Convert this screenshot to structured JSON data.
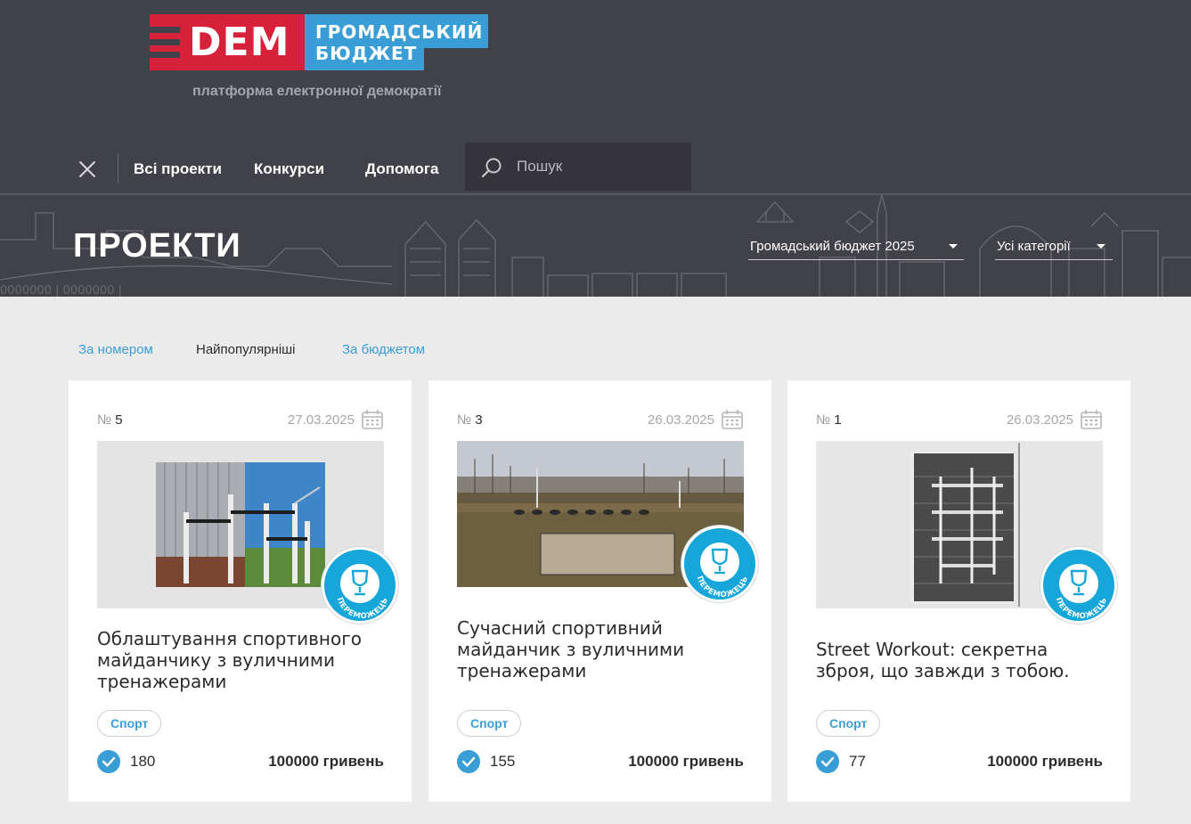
{
  "header": {
    "logo_main": "DEM",
    "logo_line1": "ГРОМАДСЬКИЙ",
    "logo_line2": "БЮДЖЕТ",
    "tagline": "платформа електронної демократії"
  },
  "nav": {
    "links": [
      "Всі проекти",
      "Конкурси",
      "Допомога"
    ],
    "search_placeholder": "Пошук"
  },
  "page": {
    "title": "ПРОЕКТИ",
    "filter_budget": "Громадський бюджет 2025",
    "filter_category": "Усі категорії"
  },
  "sort": {
    "by_number": "За номером",
    "popular": "Найпопулярніші",
    "by_budget": "За бюджетом"
  },
  "colors": {
    "header_bg": "#414149",
    "brand_red": "#d7213a",
    "brand_blue": "#3a9ed6",
    "badge_blue": "#17a6d9",
    "page_bg": "#ebebeb"
  },
  "badge_text": "ПЕРЕМОЖЕЦЬ",
  "projects": [
    {
      "num_symbol": "№",
      "num": "5",
      "date": "27.03.2025",
      "title": "Облаштування спортивного майданчику з вуличними тренажерами",
      "tag": "Спорт",
      "votes": "180",
      "budget": "100000 гривень",
      "winner": true
    },
    {
      "num_symbol": "№",
      "num": "3",
      "date": "26.03.2025",
      "title": "Сучасний спортивний майданчик з вуличними тренажерами",
      "tag": "Спорт",
      "votes": "155",
      "budget": "100000 гривень",
      "winner": true
    },
    {
      "num_symbol": "№",
      "num": "1",
      "date": "26.03.2025",
      "title": "Street Workout: секретна зброя, що завжди з тобою.",
      "tag": "Спорт",
      "votes": "77",
      "budget": "100000 гривень",
      "winner": true
    }
  ]
}
